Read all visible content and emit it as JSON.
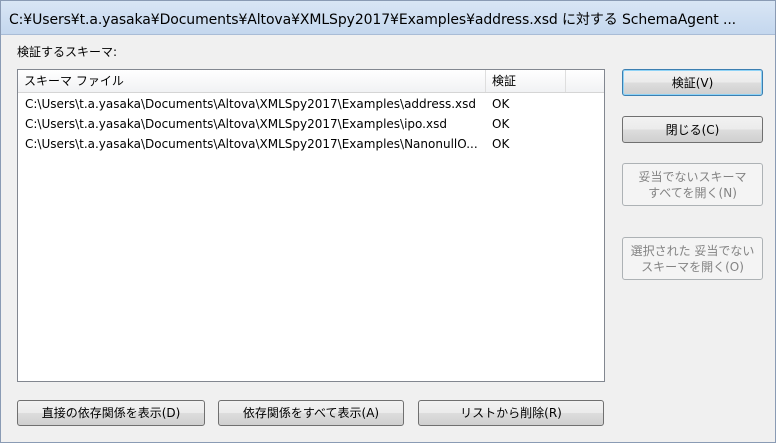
{
  "window": {
    "title": "C:¥Users¥t.a.yasaka¥Documents¥Altova¥XMLSpy2017¥Examples¥address.xsd に対する SchemaAgent ..."
  },
  "group_label": "検証するスキーマ:",
  "list": {
    "headers": [
      "スキーマ ファイル",
      "検証"
    ],
    "rows": [
      {
        "file": "C:\\Users\\t.a.yasaka\\Documents\\Altova\\XMLSpy2017\\Examples\\address.xsd",
        "status": "OK"
      },
      {
        "file": "C:\\Users\\t.a.yasaka\\Documents\\Altova\\XMLSpy2017\\Examples\\ipo.xsd",
        "status": "OK"
      },
      {
        "file": "C:\\Users\\t.a.yasaka\\Documents\\Altova\\XMLSpy2017\\Examples\\NanonullO...",
        "status": "OK"
      }
    ]
  },
  "buttons": {
    "validate": "検証(V)",
    "close": "閉じる(C)",
    "open_invalid_line1": "妥当でないスキーマ",
    "open_invalid_line2": "すべてを開く(N)",
    "open_selected_line1": "選択された 妥当でない",
    "open_selected_line2": "スキーマを開く(O)",
    "show_direct": "直接の依存関係を表示(D)",
    "show_all": "依存関係をすべて表示(A)",
    "remove": "リストから削除(R)"
  }
}
